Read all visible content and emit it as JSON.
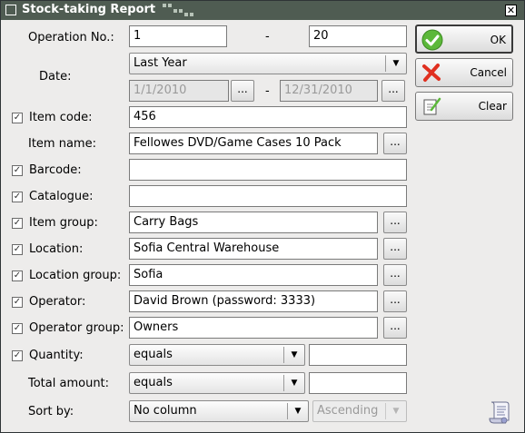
{
  "window": {
    "title": "Stock-taking Report",
    "close_glyph": "✕"
  },
  "fields": {
    "operation_no": {
      "label": "Operation No.:",
      "from": "1",
      "separator": "-",
      "to": "20"
    },
    "date": {
      "label": "Date:",
      "period": "Last Year",
      "from": "1/1/2010",
      "separator": "-",
      "to": "12/31/2010"
    },
    "item_code": {
      "label": "Item code:",
      "value": "456",
      "checked": true
    },
    "item_name": {
      "label": "Item name:",
      "value": "Fellowes DVD/Game Cases 10 Pack"
    },
    "barcode": {
      "label": "Barcode:",
      "value": "",
      "checked": true
    },
    "catalogue": {
      "label": "Catalogue:",
      "value": "",
      "checked": true
    },
    "item_group": {
      "label": "Item group:",
      "value": "Carry Bags",
      "checked": true
    },
    "location": {
      "label": "Location:",
      "value": "Sofia Central Warehouse",
      "checked": true
    },
    "location_group": {
      "label": "Location group:",
      "value": "Sofia",
      "checked": true
    },
    "operator": {
      "label": "Operator:",
      "value": "David Brown (password: 3333)",
      "checked": true
    },
    "operator_group": {
      "label": "Operator group:",
      "value": "Owners",
      "checked": true
    },
    "quantity": {
      "label": "Quantity:",
      "condition": "equals",
      "value": "",
      "checked": true
    },
    "total_amount": {
      "label": "Total amount:",
      "condition": "equals",
      "value": ""
    },
    "sort_by": {
      "label": "Sort by:",
      "column": "No column",
      "order": "Ascending"
    }
  },
  "buttons": {
    "ok": "OK",
    "cancel": "Cancel",
    "clear": "Clear",
    "browse": "..."
  },
  "glyphs": {
    "check": "✓",
    "dropdown": "▼"
  },
  "colors": {
    "titlebar": "#4f5c52",
    "ok_icon": "#5cb83a",
    "cancel_icon": "#e03020"
  }
}
